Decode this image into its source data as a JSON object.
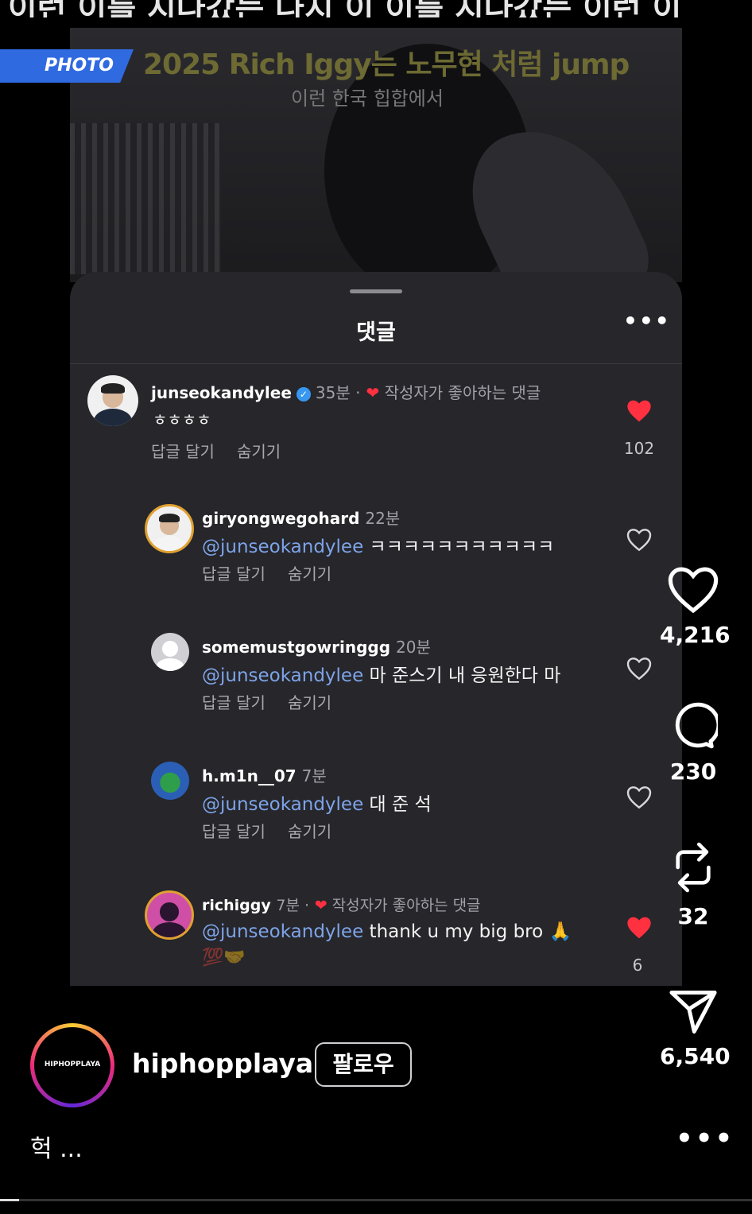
{
  "top_strip_text": "이런 이를 지나갔는 나지 이 이를 지나갔는 이런 이",
  "photo": {
    "badge": "PHOTO",
    "title": "2025 Rich Iggy는 노무현 처럼 jump",
    "subtitle": "이런 한국 힙합에서"
  },
  "sheet": {
    "title": "댓글",
    "more": "•••"
  },
  "comments": [
    {
      "user": "junseokandylee",
      "verified": true,
      "time": "35분 ·",
      "liked_by_creator": "작성자가 좋아하는 댓글",
      "text": "ㅎㅎㅎㅎ",
      "reply": "답글 달기",
      "hide": "숨기기",
      "likes": "102",
      "liked": true
    },
    {
      "user": "giryongwegohard",
      "time": "22분",
      "mention": "@junseokandylee",
      "text": " ㅋㅋㅋㅋㅋㅋㅋㅋㅋㅋㅋ",
      "reply": "답글 달기",
      "hide": "숨기기",
      "liked": false
    },
    {
      "user": "somemustgowringgg",
      "time": "20분",
      "mention": "@junseokandylee",
      "text": " 마 준스기 내 응원한다 마",
      "reply": "답글 달기",
      "hide": "숨기기",
      "liked": false
    },
    {
      "user": "h.m1n__07",
      "time": "7분",
      "mention": "@junseokandylee",
      "text": " 대 준 석",
      "reply": "답글 달기",
      "hide": "숨기기",
      "liked": false
    },
    {
      "user": "richiggy",
      "time": "7분 ·",
      "liked_by_creator": "작성자가 좋아하는 댓글",
      "mention": "@junseokandylee",
      "text": " thank u my big bro 🙏",
      "extra": "💯🤝",
      "likes": "6",
      "liked": true
    }
  ],
  "side_actions": {
    "likes": "4,216",
    "comments": "230",
    "reposts": "32",
    "shares": "6,540"
  },
  "post": {
    "avatar_text": "HIPHOPPLAYA",
    "username": "hiphopplaya",
    "follow_label": "팔로우",
    "caption": "헉 ...",
    "more": "•••"
  },
  "colors": {
    "accent_blue": "#2f6ae0",
    "like_red": "#ff3040",
    "mention_blue": "#7ea4e8",
    "sheet_bg": "#26262b"
  }
}
